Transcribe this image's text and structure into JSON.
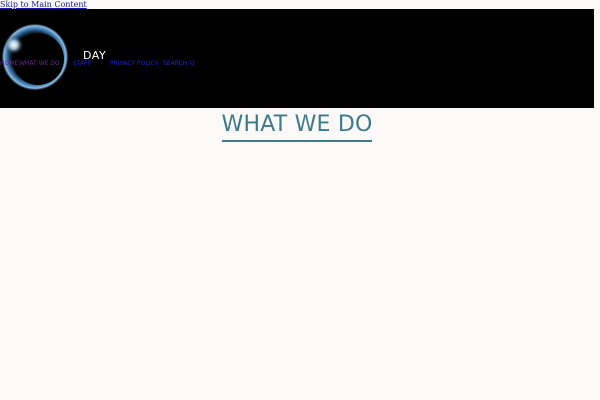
{
  "skip_link": {
    "label": "Skip to Main Content"
  },
  "header": {
    "site_title": "DAY",
    "nav": {
      "items": [
        {
          "label": "HOME"
        },
        {
          "label": "WHAT WE DO"
        },
        {
          "label": "STAFF"
        },
        {
          "label": "PRIVACY POLICY"
        },
        {
          "label": "SEARCH"
        },
        {
          "label": "Q"
        }
      ]
    }
  },
  "main": {
    "title": "WHAT WE DO"
  },
  "colors": {
    "header_bg": "#000000",
    "page_bg": "#fbf9f8",
    "title_accent": "#3f7a8b",
    "link": "#2222cc",
    "visited_link": "#6b2a8f"
  },
  "icons": {
    "logo": "eclipse-logo-icon"
  }
}
